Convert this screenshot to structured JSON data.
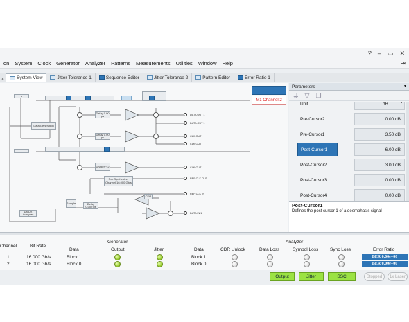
{
  "window_controls": [
    "?",
    "–",
    "▭",
    "✕"
  ],
  "menu": [
    "on",
    "System",
    "Clock",
    "Generator",
    "Analyzer",
    "Patterns",
    "Measurements",
    "Utilities",
    "Window",
    "Help"
  ],
  "menu_right_icon": "pin-icon",
  "tabs": [
    {
      "label": "System View",
      "active": true,
      "icon": "system-icon"
    },
    {
      "label": "Jitter Tolerance 1",
      "active": false,
      "icon": "chart-icon"
    },
    {
      "label": "Sequence Editor",
      "active": false,
      "icon": "sequence-icon"
    },
    {
      "label": "Jitter Tolerance 2",
      "active": false,
      "icon": "chart-icon"
    },
    {
      "label": "Pattern Editor",
      "active": false,
      "icon": "pattern-icon"
    },
    {
      "label": "Error Ratio 1",
      "active": false,
      "icon": "error-icon"
    }
  ],
  "diagram": {
    "channel_label": "M1 Channel 2",
    "blocks": {
      "gen": "Data Generation",
      "dmux": "DMUX Analyzer",
      "sample": "Sample",
      "delay1": "Delay\n0.00 ps",
      "delay2": "Delay\n0.00 ps",
      "delay3": "Delay\n0.000 ps",
      "divider": "Divider\n÷ 2",
      "synth": "Pcc Synthesizer\nChannel\n16.000 Gb/s",
      "cdr": "CDR",
      "deemph": "DeEmphasis",
      "out1": "DATA OUT 1",
      "out1n": "DATA OUT 1",
      "clk": "CLK OUT",
      "clkn": "CLK OUT",
      "refout": "REF CLK OUT",
      "refin": "REF CLK IN",
      "datain": "DATA IN 1",
      "clkin": "CLK IN"
    }
  },
  "parameters": {
    "title": "Parameters",
    "rows": [
      {
        "label": "Unit",
        "value": "dB",
        "dropdown": true
      },
      {
        "label": "Pre-Cursor2",
        "value": "0.00 dB"
      },
      {
        "label": "Pre-Cursor1",
        "value": "3.50 dB"
      },
      {
        "label": "Post-Cursor1",
        "value": "6.00 dB",
        "selected": true
      },
      {
        "label": "Post-Cursor2",
        "value": "3.00 dB"
      },
      {
        "label": "Post-Cursor3",
        "value": "0.00 dB"
      },
      {
        "label": "Post-Cursor4",
        "value": "0.00 dB"
      }
    ],
    "desc_title": "Post-Cursor1",
    "desc_text": "Defines the post cursor 1 of a deemphasis signal"
  },
  "grid": {
    "headers": {
      "channel": "Channel",
      "bitrate": "Bit Rate",
      "generator": "Generator",
      "gen_data": "Data",
      "output": "Output",
      "jitter": "Jitter",
      "analyzer": "Analyzer",
      "an_data": "Data",
      "cdr": "CDR Unlock",
      "dataloss": "Data Loss",
      "symloss": "Symbol Loss",
      "syncloss": "Sync Loss",
      "err": "Error Ratio"
    },
    "rows": [
      {
        "channel": "1",
        "bitrate": "16.000 Gb/s",
        "gen_data": "Block 1",
        "an_data": "Block 1",
        "ber": "BER 0.00e+00"
      },
      {
        "channel": "2",
        "bitrate": "16.000 Gb/s",
        "gen_data": "Block 0",
        "an_data": "Block 0",
        "ber": "BER 0.00e+00"
      }
    ]
  },
  "buttons": {
    "output": "Output",
    "jitter": "Jitter",
    "ssc": "SSC",
    "stopped": "Stopped",
    "fmode": "1x Laser"
  },
  "colors": {
    "accent_blue": "#2e75b6",
    "led_green": "#9acd32",
    "button_green": "#9be243",
    "channel_red": "#dd2222"
  }
}
